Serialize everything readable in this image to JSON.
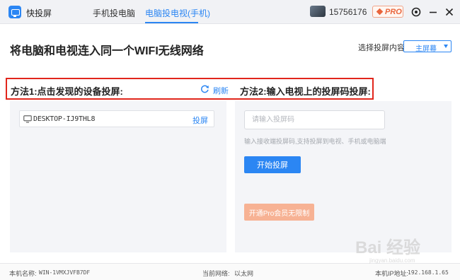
{
  "app": {
    "name": "快投屏"
  },
  "tabs": [
    {
      "label": "手机投电脑",
      "active": false
    },
    {
      "label": "电脑投电视(手机)",
      "active": true
    }
  ],
  "user": {
    "id": "15756176"
  },
  "pro_badge": {
    "label": "PRO"
  },
  "icons": {
    "logo": "tv-logo-icon",
    "settings": "settings-icon",
    "minimize": "minimize-icon",
    "close": "close-icon",
    "refresh": "refresh-icon",
    "device": "monitor-icon"
  },
  "header": {
    "headline": "将电脑和电视连入同一个WIFI无线网络"
  },
  "cast_select": {
    "label": "选择投屏内容:",
    "value": "主屏幕"
  },
  "method1": {
    "title": "方法1:点击发现的设备投屏:",
    "refresh_label": "刷新",
    "devices": [
      {
        "name": "DESKTOP-IJ9THL8",
        "action": "投屏"
      }
    ]
  },
  "method2": {
    "title": "方法2:输入电视上的投屏码投屏:",
    "input_placeholder": "请输入投屏码",
    "hint": "输入接收端投屏码,支持投屏到电视、手机或电脑端",
    "start_label": "开始投屏",
    "pro_label": "开通Pro会员无限制"
  },
  "status_bar": {
    "machine_label": "本机名称:",
    "machine_value": "WIN-1VMXJVFB7DF",
    "network_label": "当前网络:",
    "network_value": "以太网",
    "ip_label": "本机IP地址:",
    "ip_value": "192.168.1.65"
  },
  "watermark": {
    "text": "Bai 经验",
    "sub": "jingyan.baidu.com"
  },
  "colors": {
    "accent": "#2b86f3",
    "highlight_frame": "#e1261c",
    "pro_orange": "#e9653c",
    "pro_button": "#f7b294",
    "panel_bg": "#f4f5f8"
  }
}
